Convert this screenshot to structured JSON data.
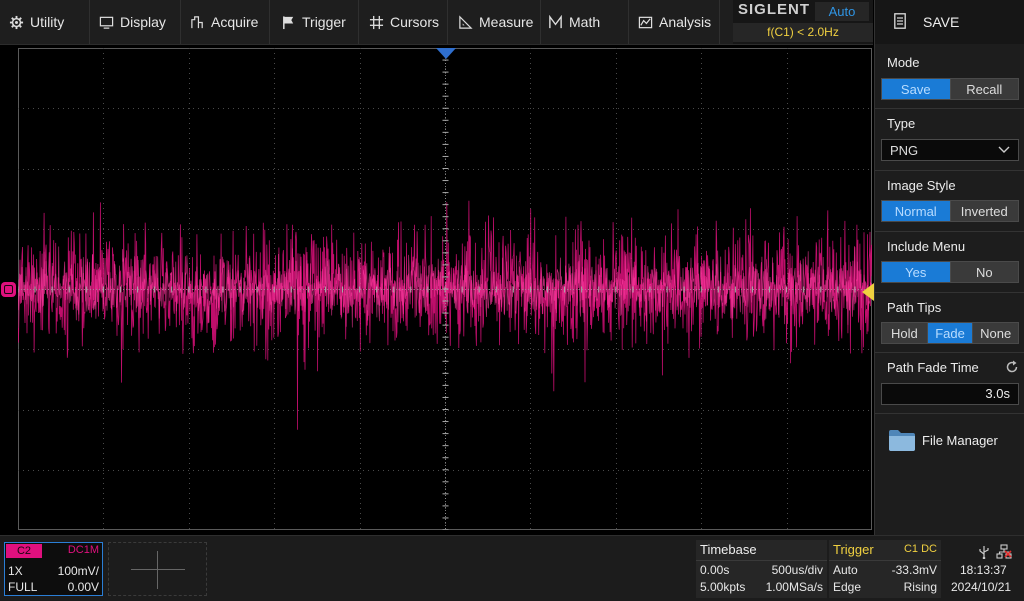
{
  "menu": {
    "utility": "Utility",
    "display": "Display",
    "acquire": "Acquire",
    "trigger": "Trigger",
    "cursors": "Cursors",
    "measure": "Measure",
    "math": "Math",
    "analysis": "Analysis"
  },
  "brand": {
    "logo": "SIGLENT",
    "mode": "Auto",
    "freq": "f(C1) < 2.0Hz"
  },
  "panel": {
    "title": "SAVE",
    "mode": {
      "label": "Mode",
      "options": [
        "Save",
        "Recall"
      ],
      "selected": "Save"
    },
    "type": {
      "label": "Type",
      "value": "PNG"
    },
    "image_style": {
      "label": "Image Style",
      "options": [
        "Normal",
        "Inverted"
      ],
      "selected": "Normal"
    },
    "include_menu": {
      "label": "Include Menu",
      "options": [
        "Yes",
        "No"
      ],
      "selected": "Yes"
    },
    "path_tips": {
      "label": "Path Tips",
      "options": [
        "Hold",
        "Fade",
        "None"
      ],
      "selected": "Fade"
    },
    "path_fade_time": {
      "label": "Path Fade Time",
      "value": "3.0s"
    },
    "file_manager": "File Manager"
  },
  "channel": {
    "tag": "C2",
    "coupling": "DC1M",
    "probe": "1X",
    "scale": "100mV/",
    "bandwidth": "FULL",
    "offset": "0.00V",
    "color": "#e0107e"
  },
  "timebase": {
    "label": "Timebase",
    "delay": "0.00s",
    "scale": "500us/div",
    "points": "5.00kpts",
    "rate": "1.00MSa/s"
  },
  "trigger": {
    "label": "Trigger",
    "source": "C1 DC",
    "mode": "Auto",
    "level": "-33.3mV",
    "type": "Edge",
    "slope": "Rising"
  },
  "status": {
    "time": "18:13:37",
    "date": "2024/10/21"
  },
  "colors": {
    "accent": "#1a7bd6",
    "trace": "#e0107e",
    "trigger": "#f0d040",
    "marker_blue": "#2f95e4"
  }
}
